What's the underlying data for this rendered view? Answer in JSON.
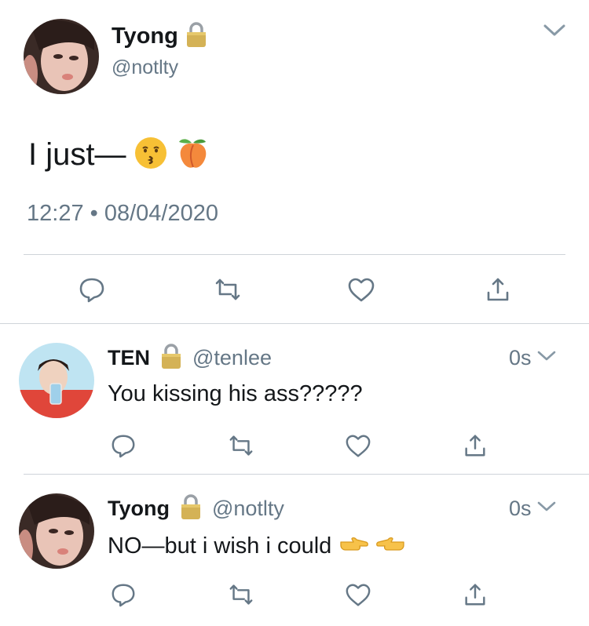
{
  "main_tweet": {
    "display_name": "Tyong",
    "handle": "@notlty",
    "text": "I just—",
    "emojis": [
      "kissing-face-icon",
      "peach-icon"
    ],
    "timestamp": "12:27 • 08/04/2020",
    "actions": [
      "reply",
      "retweet",
      "like",
      "share"
    ]
  },
  "replies": [
    {
      "display_name": "TEN",
      "handle": "@tenlee",
      "time": "0s",
      "text": "You kissing his ass?????",
      "emojis": []
    },
    {
      "display_name": "Tyong",
      "handle": "@notlty",
      "time": "0s",
      "text": "NO—but i wish i could",
      "emojis": [
        "pointing-right-icon",
        "pointing-left-icon"
      ]
    }
  ],
  "colors": {
    "text": "#14171a",
    "secondary": "#657786",
    "icon": "#657786",
    "divider": "#cfd4d9",
    "lock_gold": "#c9a84a"
  }
}
